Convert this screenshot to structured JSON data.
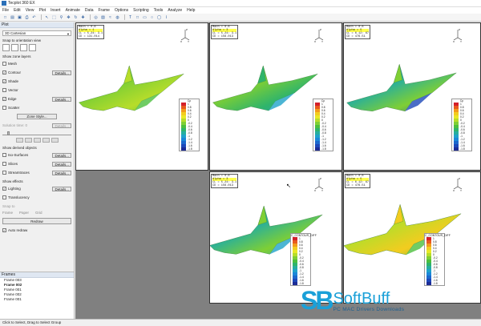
{
  "app": {
    "title": "Tecplot 360 EX"
  },
  "menu": [
    "File",
    "Edit",
    "View",
    "Plot",
    "Insert",
    "Animate",
    "Data",
    "Frame",
    "Options",
    "Scripting",
    "Tools",
    "Analyze",
    "Help"
  ],
  "toolbar_icons": [
    "new-icon",
    "open-icon",
    "save-icon",
    "print-icon",
    "undo-icon",
    "pointer-icon",
    "select-icon",
    "zoom-icon",
    "translate-icon",
    "rotate-icon",
    "probe-icon",
    "contour-add-icon",
    "slice-icon",
    "streamtrace-icon",
    "isosurface-icon",
    "text-icon",
    "square-icon",
    "rectangle-icon",
    "circle-icon",
    "ellipse-icon",
    "polyline-icon"
  ],
  "sidebar": {
    "panel_title": "Plot",
    "plot_type": "3D Cartesian",
    "orientation_label": "Snap to orientation view",
    "zone_layers_label": "Show zone layers",
    "zone_layers": [
      {
        "label": "Mesh",
        "checked": false,
        "details": false
      },
      {
        "label": "Contour",
        "checked": true,
        "details": true
      },
      {
        "label": "Shade",
        "checked": true,
        "details": false
      },
      {
        "label": "Vector",
        "checked": false,
        "details": false
      },
      {
        "label": "Edge",
        "checked": true,
        "details": true
      },
      {
        "label": "Scatter",
        "checked": false,
        "details": false
      }
    ],
    "details_label": "Details...",
    "zone_style_label": "Zone Style...",
    "solution_time_label": "Solution time:",
    "solution_time_value": "0",
    "derived_label": "Show derived objects",
    "derived": [
      {
        "label": "Iso-Surfaces",
        "checked": false
      },
      {
        "label": "Slices",
        "checked": false
      },
      {
        "label": "Streamtraces",
        "checked": false
      }
    ],
    "effects_label": "Show effects",
    "effects": [
      {
        "label": "Lighting",
        "checked": true
      },
      {
        "label": "Translucency",
        "checked": false
      }
    ],
    "snap_label": "Snap to",
    "snap_options": [
      "Frame",
      "Paper",
      "Grid"
    ],
    "redraw_label": "Redraw",
    "auto_redraw_label": "Auto redraw"
  },
  "frames_panel": {
    "title": "Frames",
    "items": [
      "Frame 003",
      "Frame 002",
      "Frame 001",
      "Frame 002",
      "Frame 001"
    ],
    "bold_index": 1
  },
  "plots": [
    {
      "mach": "0.8",
      "alpha": "1",
      "cl": "5.24: 3.1",
      "cd": "131.014",
      "legend_title": "Cp",
      "has_title": true
    },
    {
      "mach": "0.8",
      "alpha": "3",
      "cl": "5.24: 3.1",
      "cd": "156.013",
      "legend_title": "Cp",
      "has_title": true
    },
    {
      "mach": "0.8",
      "alpha": "5",
      "cl": "6.12: 67",
      "cd": "476.51",
      "legend_title": "Cp",
      "has_title": true
    },
    {
      "mach": "0.8",
      "alpha": "3",
      "cl": "5.24: 3.1",
      "cd": "156.013",
      "legend_title": "C_CONTOUR_DIFF",
      "has_title": true
    },
    {
      "mach": "0.8",
      "alpha": "5",
      "cl": "6.12: 67",
      "cd": "476.51",
      "legend_title": "C_CONTOUR_DIFF",
      "has_title": true
    }
  ],
  "legend_values": [
    "1",
    "0.8",
    "0.6",
    "0.4",
    "0.2",
    "0",
    "-0.2",
    "-0.4",
    "-0.6",
    "-0.8",
    "-1",
    "-1.2",
    "-1.4",
    "-1.6",
    "-1.8"
  ],
  "legend_colors": [
    "#d4202a",
    "#e85a1d",
    "#f29a1b",
    "#f3cc1f",
    "#e9e826",
    "#b7dd2a",
    "#7fcf34",
    "#4cbf3d",
    "#2fb46b",
    "#26ae9e",
    "#1fa2c9",
    "#1b87d8",
    "#1b68cd",
    "#1d48b9",
    "#1c2c96"
  ],
  "status": "Click to Select, Drag to Select Group",
  "watermark": {
    "logo": "SB",
    "name": "SoftBuff",
    "tag": "PC MAC Drivers Downloads"
  }
}
